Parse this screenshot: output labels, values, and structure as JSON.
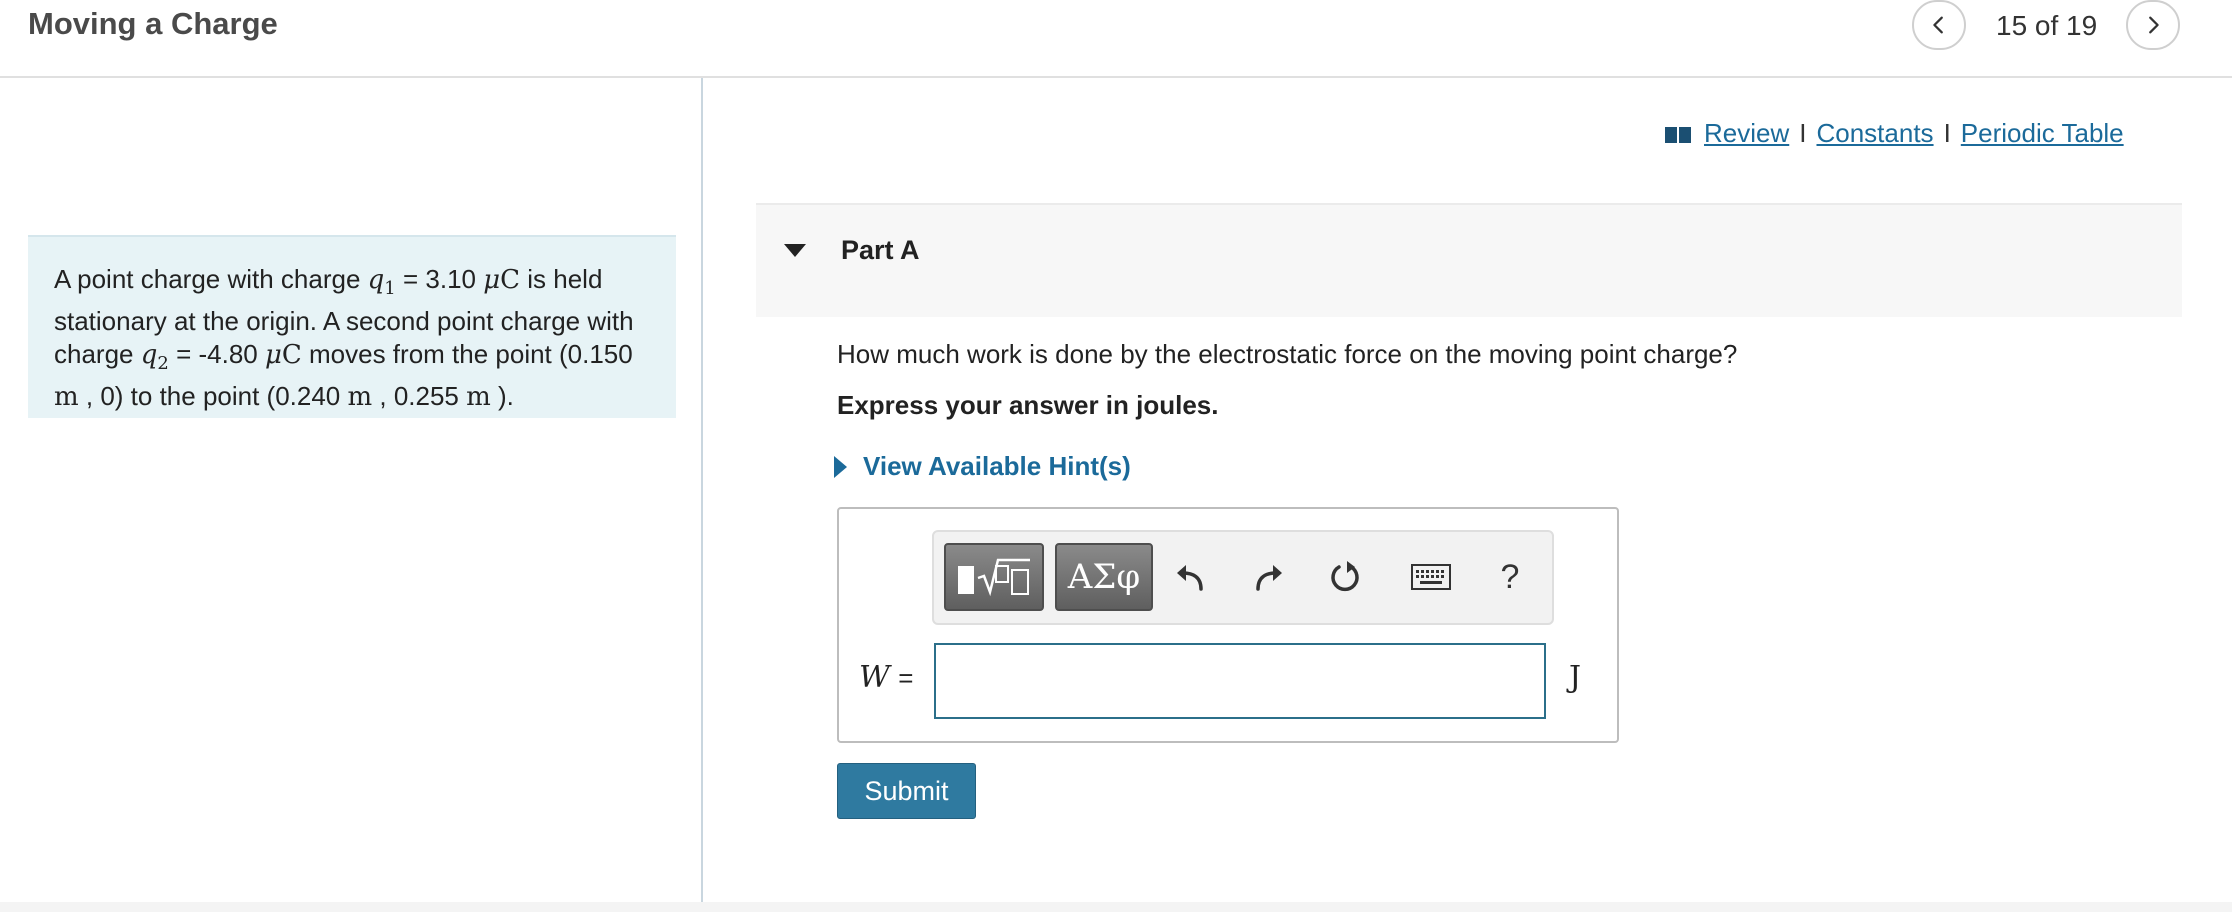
{
  "header": {
    "title": "Moving a Charge",
    "counter": "15 of 19",
    "prev_icon": "chevron-left-icon",
    "next_icon": "chevron-right-icon"
  },
  "problem": {
    "t1": "A point charge with charge ",
    "q1_sym": "q",
    "q1_sub": "1",
    "t2": " = 3.10 ",
    "mu": "μ",
    "c1": "C",
    "t3": " is held stationary at the origin. A second point charge with charge ",
    "q2_sym": "q",
    "q2_sub": "2",
    "t4": " = -4.80 ",
    "c2": "C",
    "t5": " moves from the point (0.150 ",
    "m1": "m",
    "t6": " , 0) to the point (0.240 ",
    "m2": "m",
    "t7": " , 0.255 ",
    "m3": "m",
    "t8": " )."
  },
  "links": {
    "review": "Review",
    "separator": "I",
    "constants": "Constants",
    "periodic_table": "Periodic Table",
    "icon": "book-icon"
  },
  "part": {
    "title": "Part A",
    "question": "How much work is done by the electrostatic force on the moving point charge?",
    "instruction": "Express your answer in joules.",
    "hint_label": "View Available Hint(s)"
  },
  "toolbar": {
    "greek_label": "ΑΣφ",
    "help_label": "?",
    "icons": [
      "templates-icon",
      "greek-symbols-icon",
      "undo-icon",
      "redo-icon",
      "reset-icon",
      "keyboard-icon",
      "help-icon"
    ]
  },
  "answer": {
    "variable": "W",
    "equals": "=",
    "value": "",
    "unit": "J"
  },
  "submit_label": "Submit",
  "colors": {
    "link": "#1b6a9a",
    "submit": "#2f7aa0",
    "problem_bg": "#e7f3f6"
  }
}
